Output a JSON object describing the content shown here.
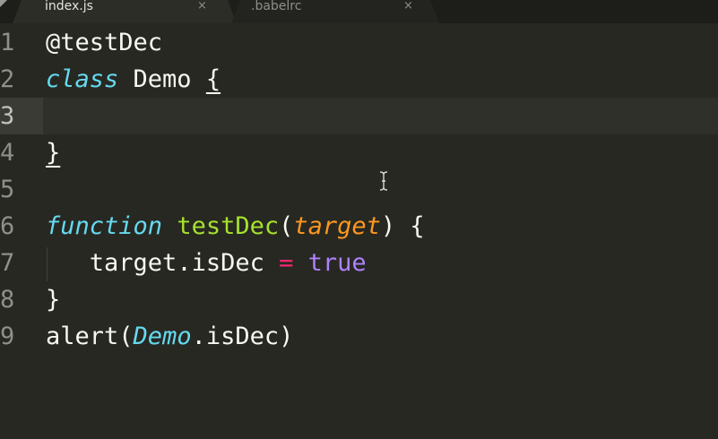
{
  "tabs": [
    {
      "label": "index.js",
      "close": "×",
      "active": true
    },
    {
      "label": ".babelrc",
      "close": "×",
      "active": false
    }
  ],
  "editor": {
    "lines": [
      {
        "number": "1"
      },
      {
        "number": "2"
      },
      {
        "number": "3"
      },
      {
        "number": "4"
      },
      {
        "number": "5"
      },
      {
        "number": "6"
      },
      {
        "number": "7"
      },
      {
        "number": "8"
      },
      {
        "number": "9"
      }
    ],
    "tokens": {
      "l1_decorator": "@testDec",
      "l2_class": "class",
      "l2_name": " Demo ",
      "l2_brace": "{",
      "l4_brace": "}",
      "l6_function": "function",
      "l6_space": " ",
      "l6_name": "testDec",
      "l6_open": "(",
      "l6_param": "target",
      "l6_close": ") {",
      "l7_indent": "   ",
      "l7_lhs": "target.isDec ",
      "l7_op": "=",
      "l7_space": " ",
      "l7_true": "true",
      "l8_brace": "}",
      "l9_alert": "alert(",
      "l9_demo": "Demo",
      "l9_rest": ".isDec)"
    },
    "current_line": "3"
  },
  "colors": {
    "background": "#272822",
    "keyword": "#66d9ef",
    "function": "#a6e22e",
    "parameter": "#fd971f",
    "operator": "#f92672",
    "boolean": "#ae81ff",
    "text": "#f8f8f2",
    "gutter": "#8f908a"
  },
  "cursor": {
    "icon": "ibeam-cursor-icon"
  }
}
